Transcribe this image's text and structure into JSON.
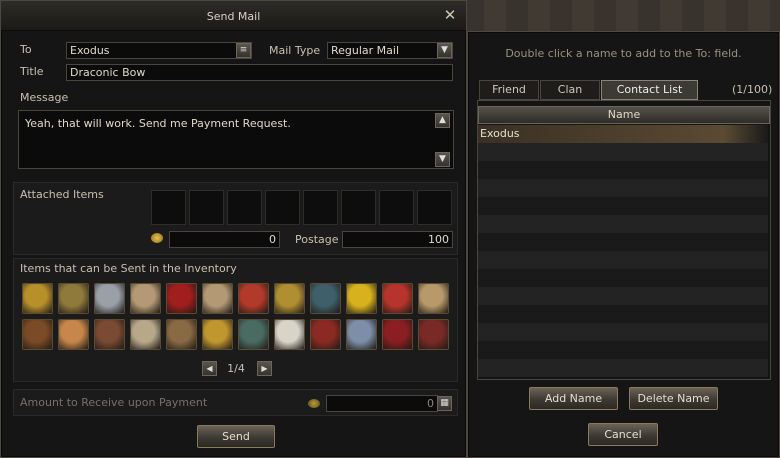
{
  "mail": {
    "title": "Send Mail",
    "to_label": "To",
    "to_value": "Exodus",
    "mail_type_label": "Mail Type",
    "mail_type_value": "Regular Mail",
    "title_label": "Title",
    "title_value": "Draconic Bow",
    "message_label": "Message",
    "message_value": "Yeah, that will work. Send me Payment Request.",
    "attached_label": "Attached Items",
    "adena_value": "0",
    "postage_label": "Postage",
    "postage_value": "100",
    "inventory_label": "Items that can be Sent in the Inventory",
    "page_indicator": "1/4",
    "amount_label": "Amount to Receive upon Payment",
    "amount_value": "0",
    "send_label": "Send",
    "inventory_items": [
      {
        "icon": "gold-nugget-icon",
        "color": "#b8902a"
      },
      {
        "icon": "treasure-box-icon",
        "color": "#8f7a3c"
      },
      {
        "icon": "silver-scroll-icon",
        "color": "#9aa0a8"
      },
      {
        "icon": "recipe-scroll-icon",
        "color": "#b39a74"
      },
      {
        "icon": "red-cloak-icon",
        "color": "#a01e1e"
      },
      {
        "icon": "recipe-scroll-icon",
        "color": "#b39a74"
      },
      {
        "icon": "red-feather-icon",
        "color": "#b23a2a"
      },
      {
        "icon": "golden-book-icon",
        "color": "#b08e32"
      },
      {
        "icon": "dark-robe-icon",
        "color": "#3f5f6a"
      },
      {
        "icon": "golden-orb-icon",
        "color": "#d7b21e"
      },
      {
        "icon": "red-heart-icon",
        "color": "#b7342c"
      },
      {
        "icon": "map-scroll-icon",
        "color": "#b89a6a"
      },
      {
        "icon": "leather-armor-icon",
        "color": "#7b4a26"
      },
      {
        "icon": "envelope-icon",
        "color": "#c7864a"
      },
      {
        "icon": "crossbow-icon",
        "color": "#7a4a32"
      },
      {
        "icon": "parchment-roll-icon",
        "color": "#b7a88a"
      },
      {
        "icon": "rifle-icon",
        "color": "#8a6a44"
      },
      {
        "icon": "gold-ring-icon",
        "color": "#c0962e"
      },
      {
        "icon": "dark-circlet-icon",
        "color": "#4a6b62"
      },
      {
        "icon": "paper-note-icon",
        "color": "#d8d4c8"
      },
      {
        "icon": "red-book-icon",
        "color": "#8a2a22"
      },
      {
        "icon": "crystal-shard-icon",
        "color": "#7d8ea8"
      },
      {
        "icon": "red-gauntlet-icon",
        "color": "#8a1e22"
      },
      {
        "icon": "red-boots-icon",
        "color": "#7a2a26"
      }
    ]
  },
  "contacts": {
    "hint": "Double click a name to add to the To: field.",
    "tabs": [
      "Friend",
      "Clan",
      "Contact List"
    ],
    "active_tab": "Contact List",
    "count": "(1/100)",
    "column_header": "Name",
    "names": [
      "Exodus"
    ],
    "add_label": "Add Name",
    "delete_label": "Delete Name",
    "cancel_label": "Cancel"
  }
}
